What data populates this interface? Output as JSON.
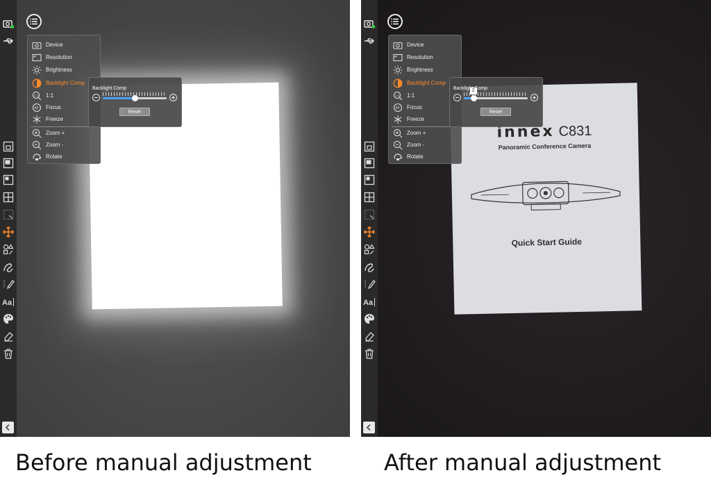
{
  "panels": {
    "before": {
      "menu_items": [
        {
          "label": "Device",
          "icon": "camera-icon"
        },
        {
          "label": "Resolution",
          "icon": "resolution-icon"
        },
        {
          "label": "Brightness",
          "icon": "brightness-icon"
        },
        {
          "label": "Backlight Comp",
          "icon": "backlight-icon"
        },
        {
          "label": "1:1",
          "icon": "one-to-one-icon"
        },
        {
          "label": "Focus",
          "icon": "focus-icon"
        },
        {
          "label": "Freeze",
          "icon": "freeze-icon"
        },
        {
          "label": "Zoom +",
          "icon": "zoom-in-icon"
        },
        {
          "label": "Zoom -",
          "icon": "zoom-out-icon"
        },
        {
          "label": "Rotate",
          "icon": "rotate-icon"
        }
      ],
      "active_item": "Backlight Comp",
      "popup": {
        "title": "Backlight Comp",
        "reset_label": "Reset",
        "slider_level": 0.5
      }
    },
    "after": {
      "menu_items": [
        {
          "label": "Device",
          "icon": "camera-icon"
        },
        {
          "label": "Resolution",
          "icon": "resolution-icon"
        },
        {
          "label": "Brightness",
          "icon": "brightness-icon"
        },
        {
          "label": "Backlight Comp",
          "icon": "backlight-icon"
        },
        {
          "label": "1:1",
          "icon": "one-to-one-icon"
        },
        {
          "label": "Focus",
          "icon": "focus-icon"
        },
        {
          "label": "Freeze",
          "icon": "freeze-icon"
        },
        {
          "label": "Zoom +",
          "icon": "zoom-in-icon"
        },
        {
          "label": "Zoom -",
          "icon": "zoom-out-icon"
        },
        {
          "label": "Rotate",
          "icon": "rotate-icon"
        }
      ],
      "active_item": "Backlight Comp",
      "popup": {
        "title": "Backlight Comp",
        "reset_label": "Reset",
        "slider_level": 0.15,
        "slider_tooltip": "2"
      },
      "document": {
        "brand": "innex",
        "model": "C831",
        "subtitle": "Panoramic Conference Camera",
        "guide_title": "Quick Start Guide"
      }
    }
  },
  "toolbar_icons": [
    "camera-status-icon",
    "usb-icon",
    "pip-icon",
    "layout-full-icon",
    "layout-corner-icon",
    "layout-grid-icon",
    "select-icon",
    "move-icon",
    "shapes-icon",
    "freehand-icon",
    "pen-icon",
    "text-icon",
    "palette-icon",
    "eraser-icon",
    "trash-icon",
    "collapse-icon"
  ],
  "colors": {
    "accent": "#ff8a2a",
    "slider_fill": "#4aa3ff",
    "camera_status": "#2ecc40"
  },
  "captions": {
    "before": "Before manual adjustment",
    "after": "After manual adjustment"
  }
}
